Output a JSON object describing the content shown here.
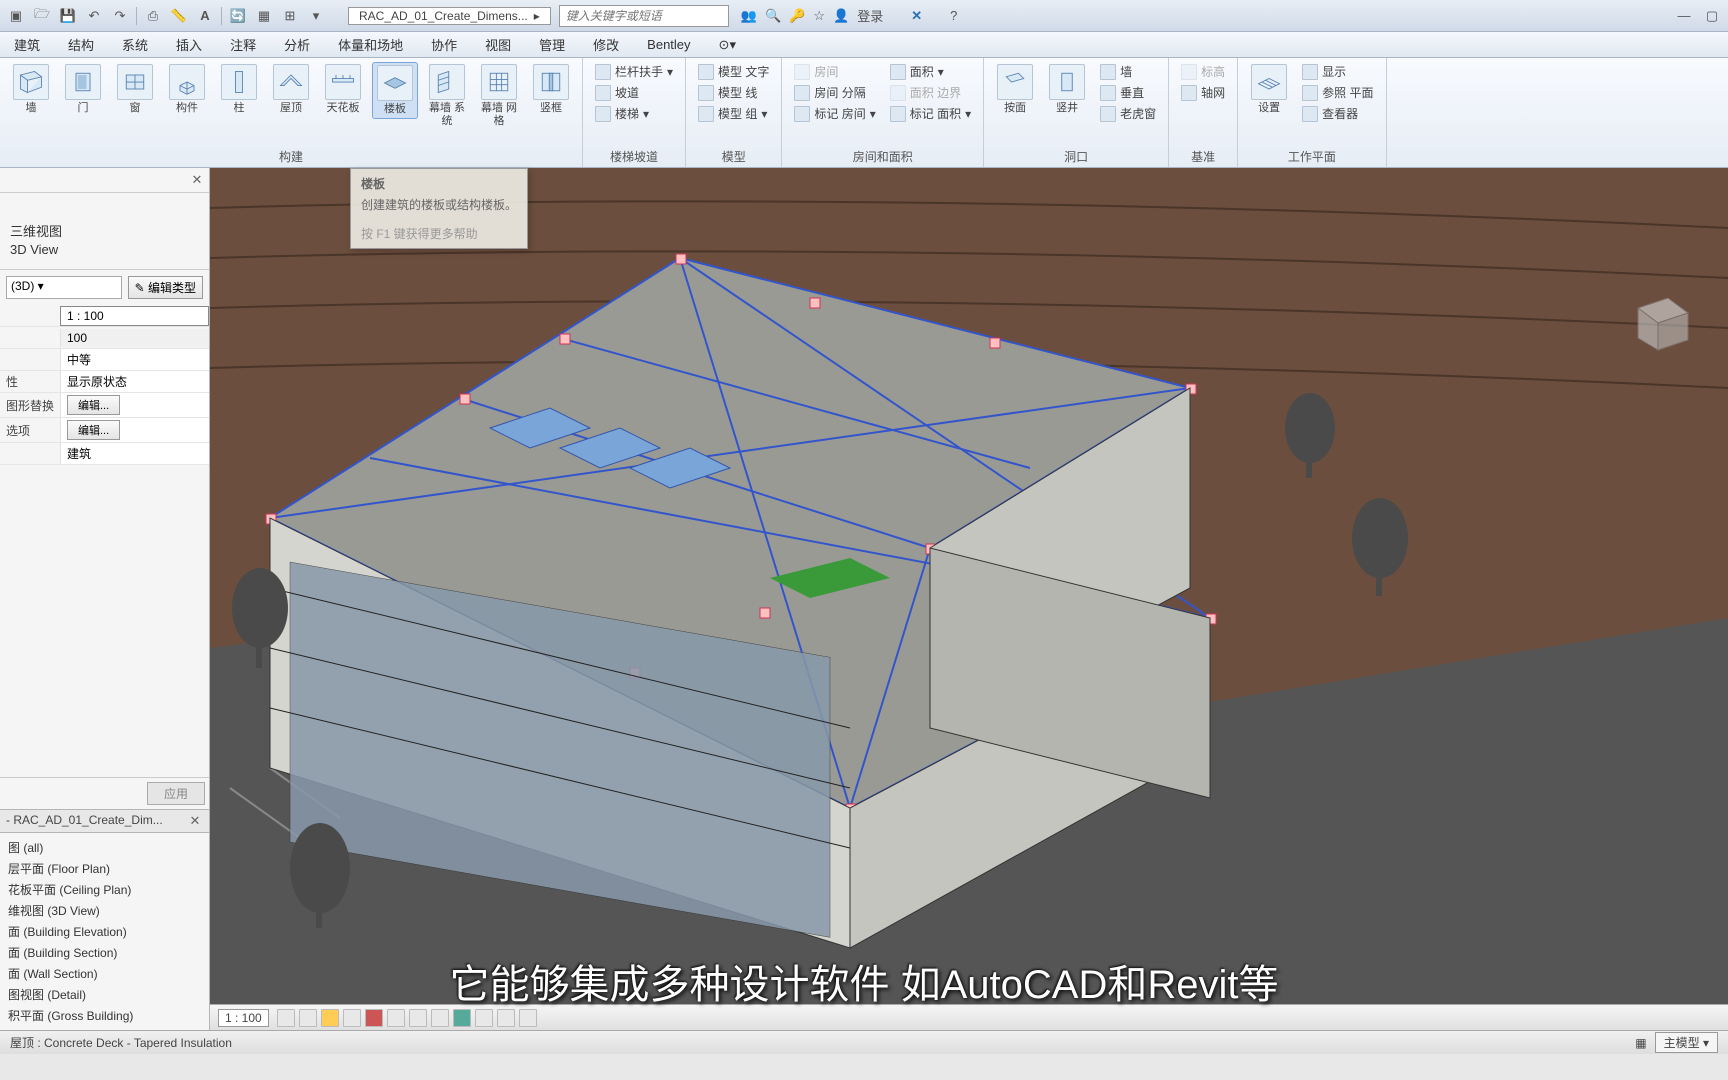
{
  "titlebar": {
    "document": "RAC_AD_01_Create_Dimens...",
    "search_placeholder": "键入关键字或短语",
    "login": "登录"
  },
  "menubar": [
    "建筑",
    "结构",
    "系统",
    "插入",
    "注释",
    "分析",
    "体量和场地",
    "协作",
    "视图",
    "管理",
    "修改",
    "Bentley"
  ],
  "ribbon": {
    "panels": [
      {
        "label": "构建",
        "big": [
          "墙",
          "门",
          "窗",
          "构件",
          "柱",
          "屋顶",
          "天花板",
          "楼板",
          "幕墙 系统",
          "幕墙 网格",
          "竖框"
        ]
      },
      {
        "label": "楼梯坡道",
        "small": [
          "栏杆扶手",
          "坡道",
          "楼梯"
        ]
      },
      {
        "label": "模型",
        "small": [
          "模型 文字",
          "模型 线",
          "模型 组"
        ]
      },
      {
        "label": "房间和面积",
        "cols": [
          [
            "房间",
            "房间 分隔",
            "标记 房间"
          ],
          [
            "面积",
            "面积 边界",
            "标记 面积"
          ]
        ]
      },
      {
        "label": "洞口",
        "big": [
          "按面",
          "竖井"
        ],
        "small": [
          "墙",
          "垂直",
          "老虎窗"
        ]
      },
      {
        "label": "基准",
        "small": [
          "标高",
          "轴网"
        ]
      },
      {
        "label": "工作平面",
        "big": [
          "设置"
        ],
        "small": [
          "显示",
          "参照 平面",
          "查看器"
        ]
      }
    ]
  },
  "tooltip": {
    "title": "楼板",
    "desc1": "创建建筑的楼板或结构楼板。",
    "desc2": "按 F1 键获得更多帮助"
  },
  "properties": {
    "view_type_cn": "三维视图",
    "view_type_en": "3D View",
    "type_dd": "(3D)",
    "edit_type": "编辑类型",
    "rows": [
      {
        "label": "",
        "value": "1 : 100",
        "scale": true
      },
      {
        "label": "",
        "value": "100"
      },
      {
        "label": "",
        "value": "中等"
      },
      {
        "label": "性",
        "value": "显示原状态"
      },
      {
        "label": "图形替换",
        "btn": "编辑..."
      },
      {
        "label": "选项",
        "btn": "编辑..."
      },
      {
        "label": "",
        "value": "建筑"
      }
    ],
    "apply": "应用"
  },
  "browser": {
    "header": "- RAC_AD_01_Create_Dim...",
    "items": [
      "图 (all)",
      "层平面 (Floor Plan)",
      "花板平面 (Ceiling Plan)",
      "维视图 (3D View)",
      "面 (Building Elevation)",
      "面 (Building Section)",
      "面 (Wall Section)",
      "图视图 (Detail)",
      "积平面 (Gross Building)"
    ]
  },
  "viewbar": {
    "scale": "1 : 100"
  },
  "statusbar": {
    "left": "屋顶 : Concrete Deck - Tapered Insulation",
    "right_dd": "主模型"
  },
  "subtitle": "它能够集成多种设计软件 如AutoCAD和Revit等"
}
